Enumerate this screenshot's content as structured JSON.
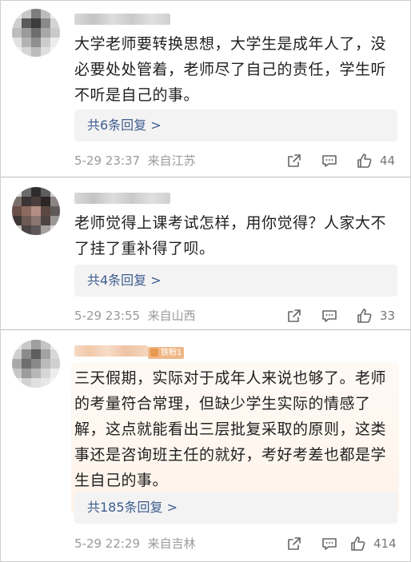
{
  "comments": [
    {
      "text": "大学老师要转换思想，大学生是成年人了，没必要处处管着，老师尽了自己的责任，学生听不听是自己的事。",
      "reply_label": "共6条回复 >",
      "time": "5-29 23:37",
      "location": "来自江苏",
      "likes": "44"
    },
    {
      "text": "老师觉得上课考试怎样，用你觉得？人家大不了挂了重补得了呗。",
      "reply_label": "共4条回复 >",
      "time": "5-29 23:55",
      "location": "来自山西",
      "likes": "33"
    },
    {
      "badge": "铁粉1",
      "text": "三天假期，实际对于成年人来说也够了。老师的考量符合常理，但缺少学生实际的情感了解，这点就能看出三层批复采取的原则，这类事还是咨询班主任的就好，考好考差也都是学生自己的事。",
      "reply_label": "共185条回复 >",
      "time": "5-29 22:29",
      "location": "来自吉林",
      "likes": "414"
    }
  ],
  "colors": {
    "reply_link": "#3f5d8f",
    "meta_gray": "#9a9a9a",
    "fan_badge": "#f0b889"
  },
  "icons": [
    "share-icon",
    "comment-icon",
    "like-icon"
  ]
}
